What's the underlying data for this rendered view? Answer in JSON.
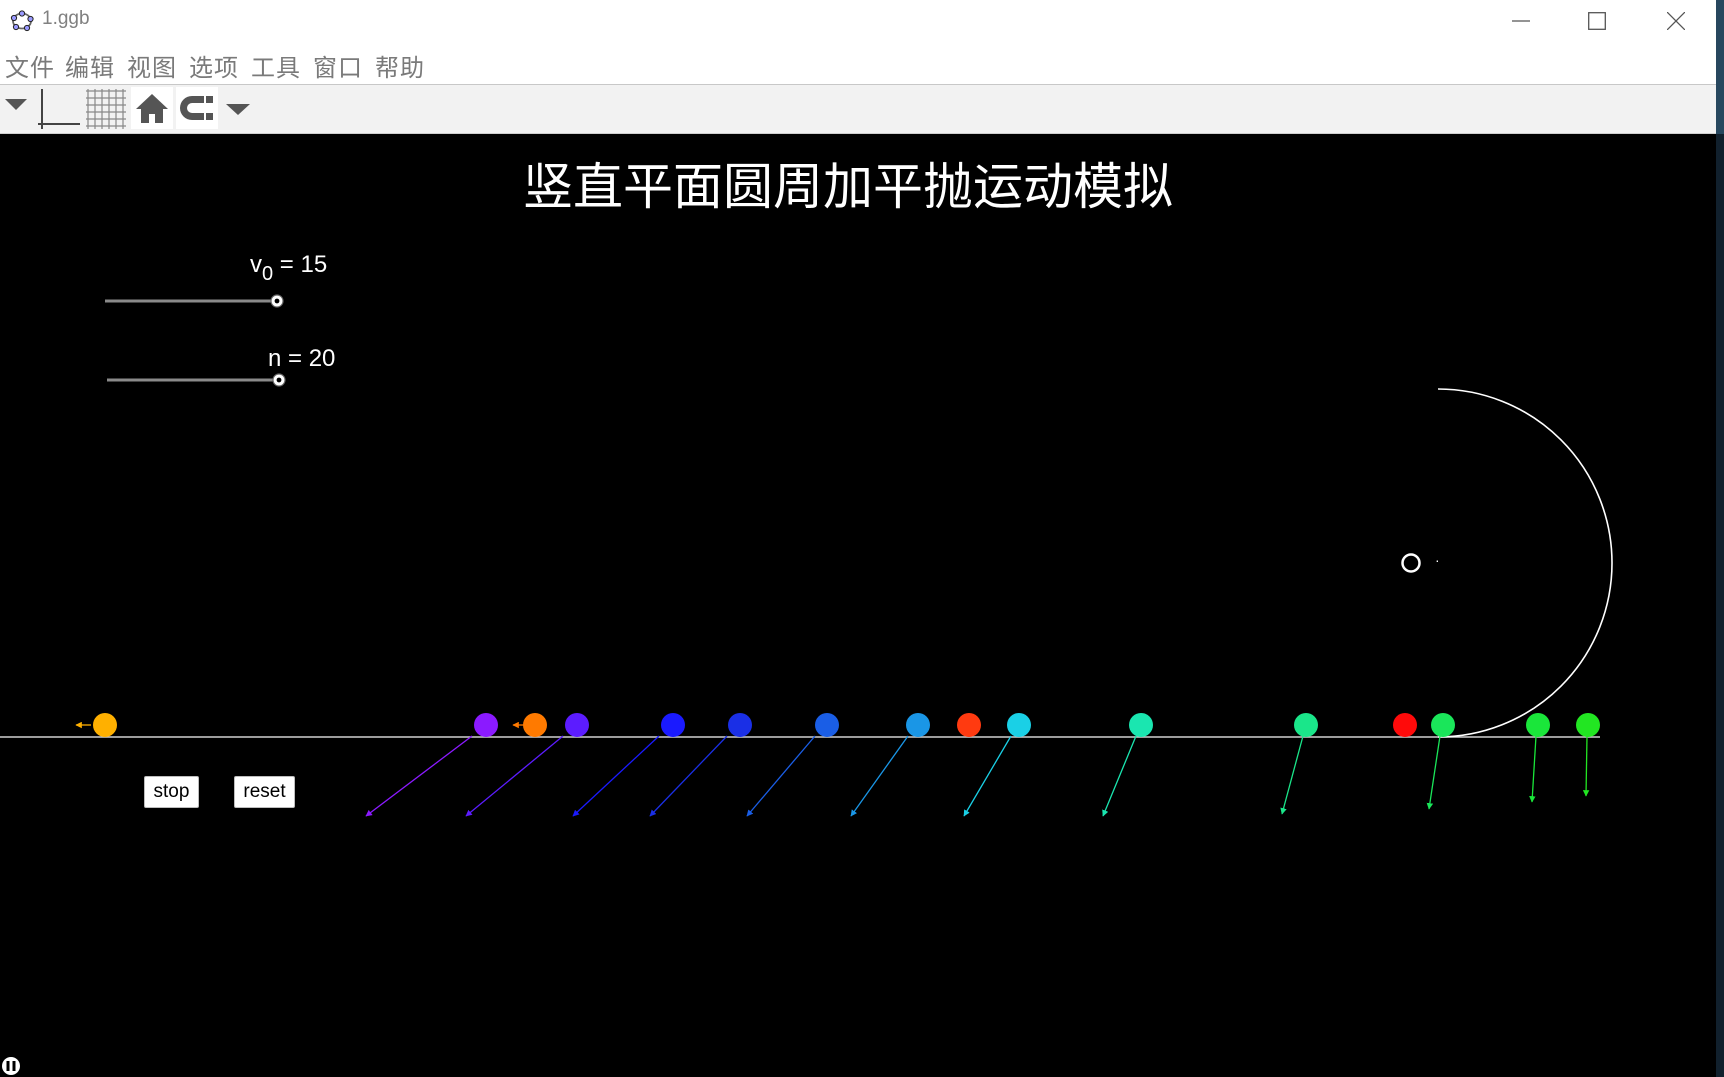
{
  "window": {
    "title": "1.ggb"
  },
  "menu": {
    "items": [
      "文件",
      "编辑",
      "视图",
      "选项",
      "工具",
      "窗口",
      "帮助"
    ]
  },
  "toolbar": {
    "icons": [
      "style-bar-toggle-icon",
      "axes-icon",
      "grid-icon",
      "home-icon",
      "point-capture-icon",
      "dropdown-icon"
    ]
  },
  "graphics": {
    "heading": "竖直平面圆周加平抛运动模拟",
    "slider_v0": {
      "label_main": "v",
      "label_sub": "0",
      "label_rest": " = 15",
      "value": 15,
      "fraction": 1.0
    },
    "slider_n": {
      "label": "n = 20",
      "value": 20,
      "fraction": 1.0
    },
    "center_label": "·",
    "buttons": {
      "stop": "stop",
      "reset": "reset"
    },
    "colors": {
      "background": "#000000",
      "track": "#ffffff"
    }
  }
}
